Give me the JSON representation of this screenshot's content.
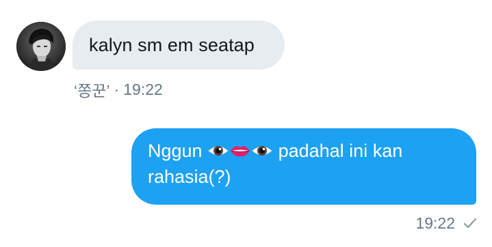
{
  "incoming": {
    "message": "kalyn sm em seatap",
    "sender": "‘쫑꾼’",
    "separator": "·",
    "time": "19:22"
  },
  "outgoing": {
    "text_before": "Nggun ",
    "emojis": [
      "eye-emoji",
      "lips-emoji",
      "eye-emoji"
    ],
    "text_after": " padahal ini kan rahasia(?)",
    "time": "19:22",
    "status_icon": "check-icon"
  },
  "colors": {
    "incoming_bubble": "#e6ecf0",
    "outgoing_bubble": "#1da1f2",
    "meta_text": "#657786",
    "message_text": "#14171a"
  }
}
